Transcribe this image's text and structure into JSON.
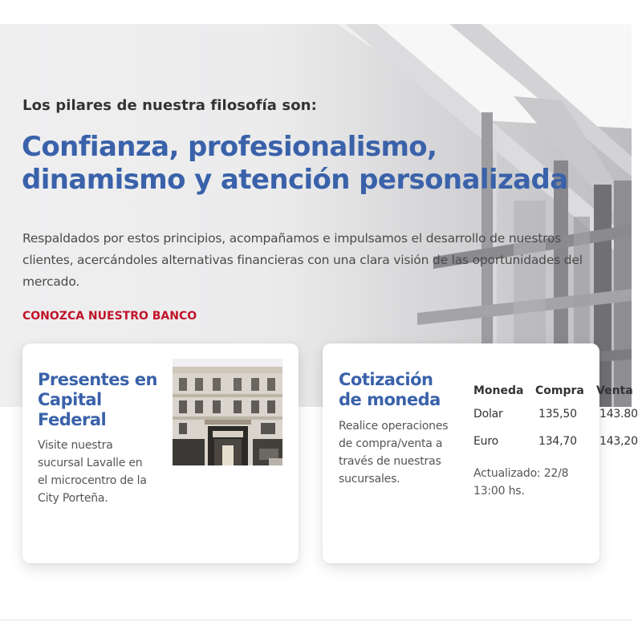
{
  "hero": {
    "subtitle": "Los pilares de nuestra filosofía son:",
    "title_line1": "Confianza, profesionalismo,",
    "title_line2": "dinamismo y atención personalizada",
    "body": "Respaldados por estos principios, acompañamos e impulsamos el desarrollo de nuestros clientes, acercándoles alternativas financieras con una clara visión de las oportunidades del mercado.",
    "cta_label": "CONOZCA NUESTRO BANCO"
  },
  "branch_card": {
    "title": "Presentes en Capital Federal",
    "text": "Visite nuestra sucursal Lavalle en el microcentro de la City Porteña."
  },
  "rates_card": {
    "title": "Cotización de moneda",
    "text": "Realice operaciones de compra/venta a través de nuestras sucursales.",
    "headers": [
      "Moneda",
      "Compra",
      "Venta"
    ],
    "rows": [
      [
        "Dolar",
        "135,50",
        "143.80"
      ],
      [
        "Euro",
        "134,70",
        "143,20"
      ]
    ],
    "updated": "Actualizado: 22/8 13:00 hs."
  },
  "colors": {
    "accent_blue": "#3a62aa",
    "cta_red": "#c0142a"
  }
}
